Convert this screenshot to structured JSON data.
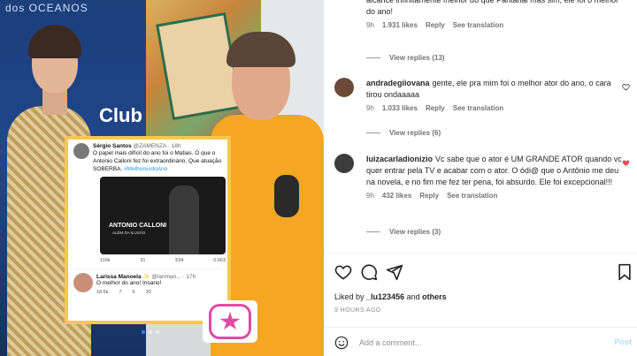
{
  "media": {
    "brand_text": "dos OCEANOS",
    "club_text": "Club",
    "tweet": {
      "author_name": "Sérgio Santos",
      "author_handle": "@ZAMENZA · 18h",
      "text": "O papel mais difícil do ano foi o Matias. O que o Antonio Calloni fez foi extraordinário. Que atuação SOBERBA.",
      "hashtag": "#MelhoresdoAno",
      "video_title": "ANTONIO CALLONI",
      "video_subtitle": "ALÉM DA ILUSÃO",
      "stats": [
        "116k",
        "31",
        "534",
        "0.663"
      ],
      "reply_name": "Larissa Manoela ✨",
      "reply_handle": "@lariman... · 17h",
      "reply_text": "O melhor do ano! Insano!",
      "reply_stats": [
        "18.5k",
        "7",
        "6",
        "30"
      ]
    }
  },
  "comments": [
    {
      "user": "",
      "text": "alcance infinitamente melhor do que Pantanal mas sim, ele foi o melhor do ano!",
      "time": "9h",
      "likes": "1.931 likes",
      "reply": "Reply",
      "translate": "See translation",
      "view_replies": "View replies (13)",
      "liked": false
    },
    {
      "user": "andradegiiovana",
      "text": "gente, ele pra mim foi o melhor ator do ano, o cara tirou ondaaaaa",
      "time": "9h",
      "likes": "1.033 likes",
      "reply": "Reply",
      "translate": "See translation",
      "view_replies": "View replies (6)",
      "liked": false
    },
    {
      "user": "luizacarladionizio",
      "text": "Vc sabe que o ator é UM GRANDE ATOR quando vc quer entrar pela TV e acabar com o ator. O ódi@ que o Antônio me deu na novela, e no fim me fez ter pena, foi absurdo. Ele foi excepcional!!!",
      "time": "9h",
      "likes": "432 likes",
      "reply": "Reply",
      "translate": "See translation",
      "view_replies": "View replies (3)",
      "liked": true
    }
  ],
  "liked_by": {
    "prefix": "Liked by",
    "user": "_lu123456",
    "middle": "and",
    "others": "others"
  },
  "time_ago": "9 HOURS AGO",
  "add_comment": {
    "placeholder": "Add a comment...",
    "post_label": "Post"
  },
  "colors": {
    "liked_heart": "#ed4956",
    "link_blue": "#1d9bf0",
    "post_disabled": "#b2dffc"
  }
}
